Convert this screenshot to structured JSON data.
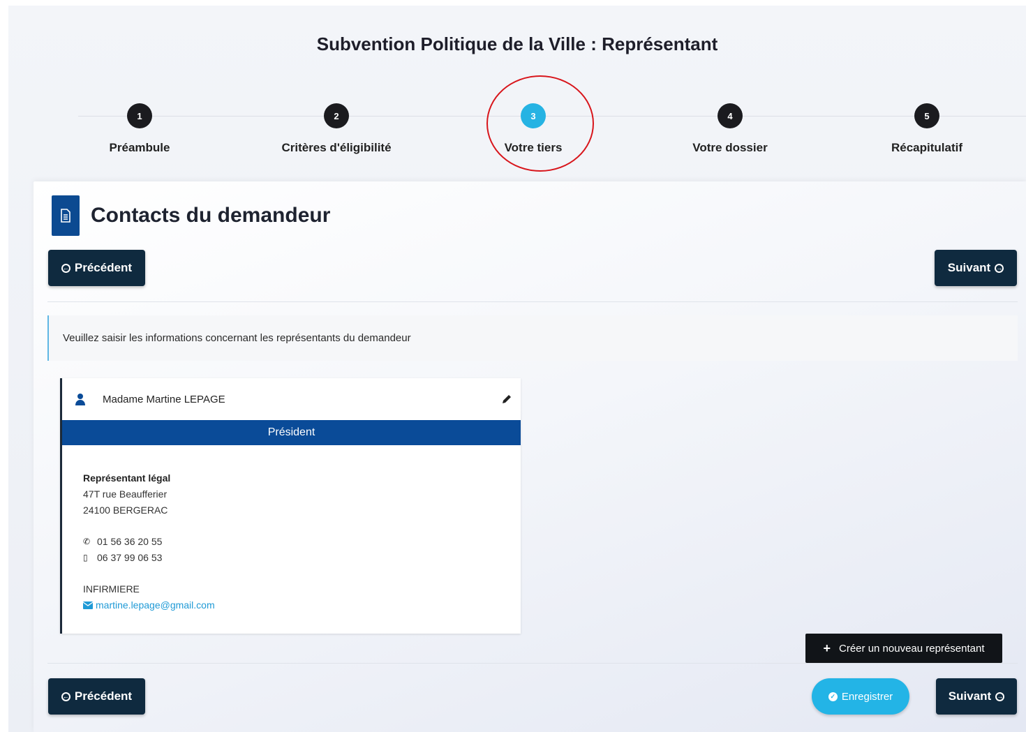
{
  "page": {
    "title": "Subvention Politique de la Ville : Représentant"
  },
  "steps": [
    {
      "num": "1",
      "label": "Préambule"
    },
    {
      "num": "2",
      "label": "Critères d'éligibilité"
    },
    {
      "num": "3",
      "label": "Votre tiers",
      "active": true
    },
    {
      "num": "4",
      "label": "Votre dossier"
    },
    {
      "num": "5",
      "label": "Récapitulatif"
    }
  ],
  "section": {
    "title": "Contacts du demandeur"
  },
  "nav": {
    "prev_label": "Précédent",
    "next_label": "Suivant",
    "save_label": "Enregistrer"
  },
  "info": {
    "text": "Veuillez saisir les informations concernant les représentants du demandeur"
  },
  "contact": {
    "name": "Madame Martine LEPAGE",
    "role": "Président",
    "type": "Représentant légal",
    "address1": "47T rue Beaufferier",
    "address2": "24100 BERGERAC",
    "phone": "01 56 36 20 55",
    "mobile": "06 37 99 06 53",
    "job": "INFIRMIERE",
    "email": "martine.lepage@gmail.com"
  },
  "actions": {
    "create_label": "Créer un nouveau représentant"
  },
  "colors": {
    "accent": "#23b4e6",
    "primary": "#0a4b98",
    "dark": "#0f2a3f",
    "highlight_ring": "#d8151b"
  }
}
